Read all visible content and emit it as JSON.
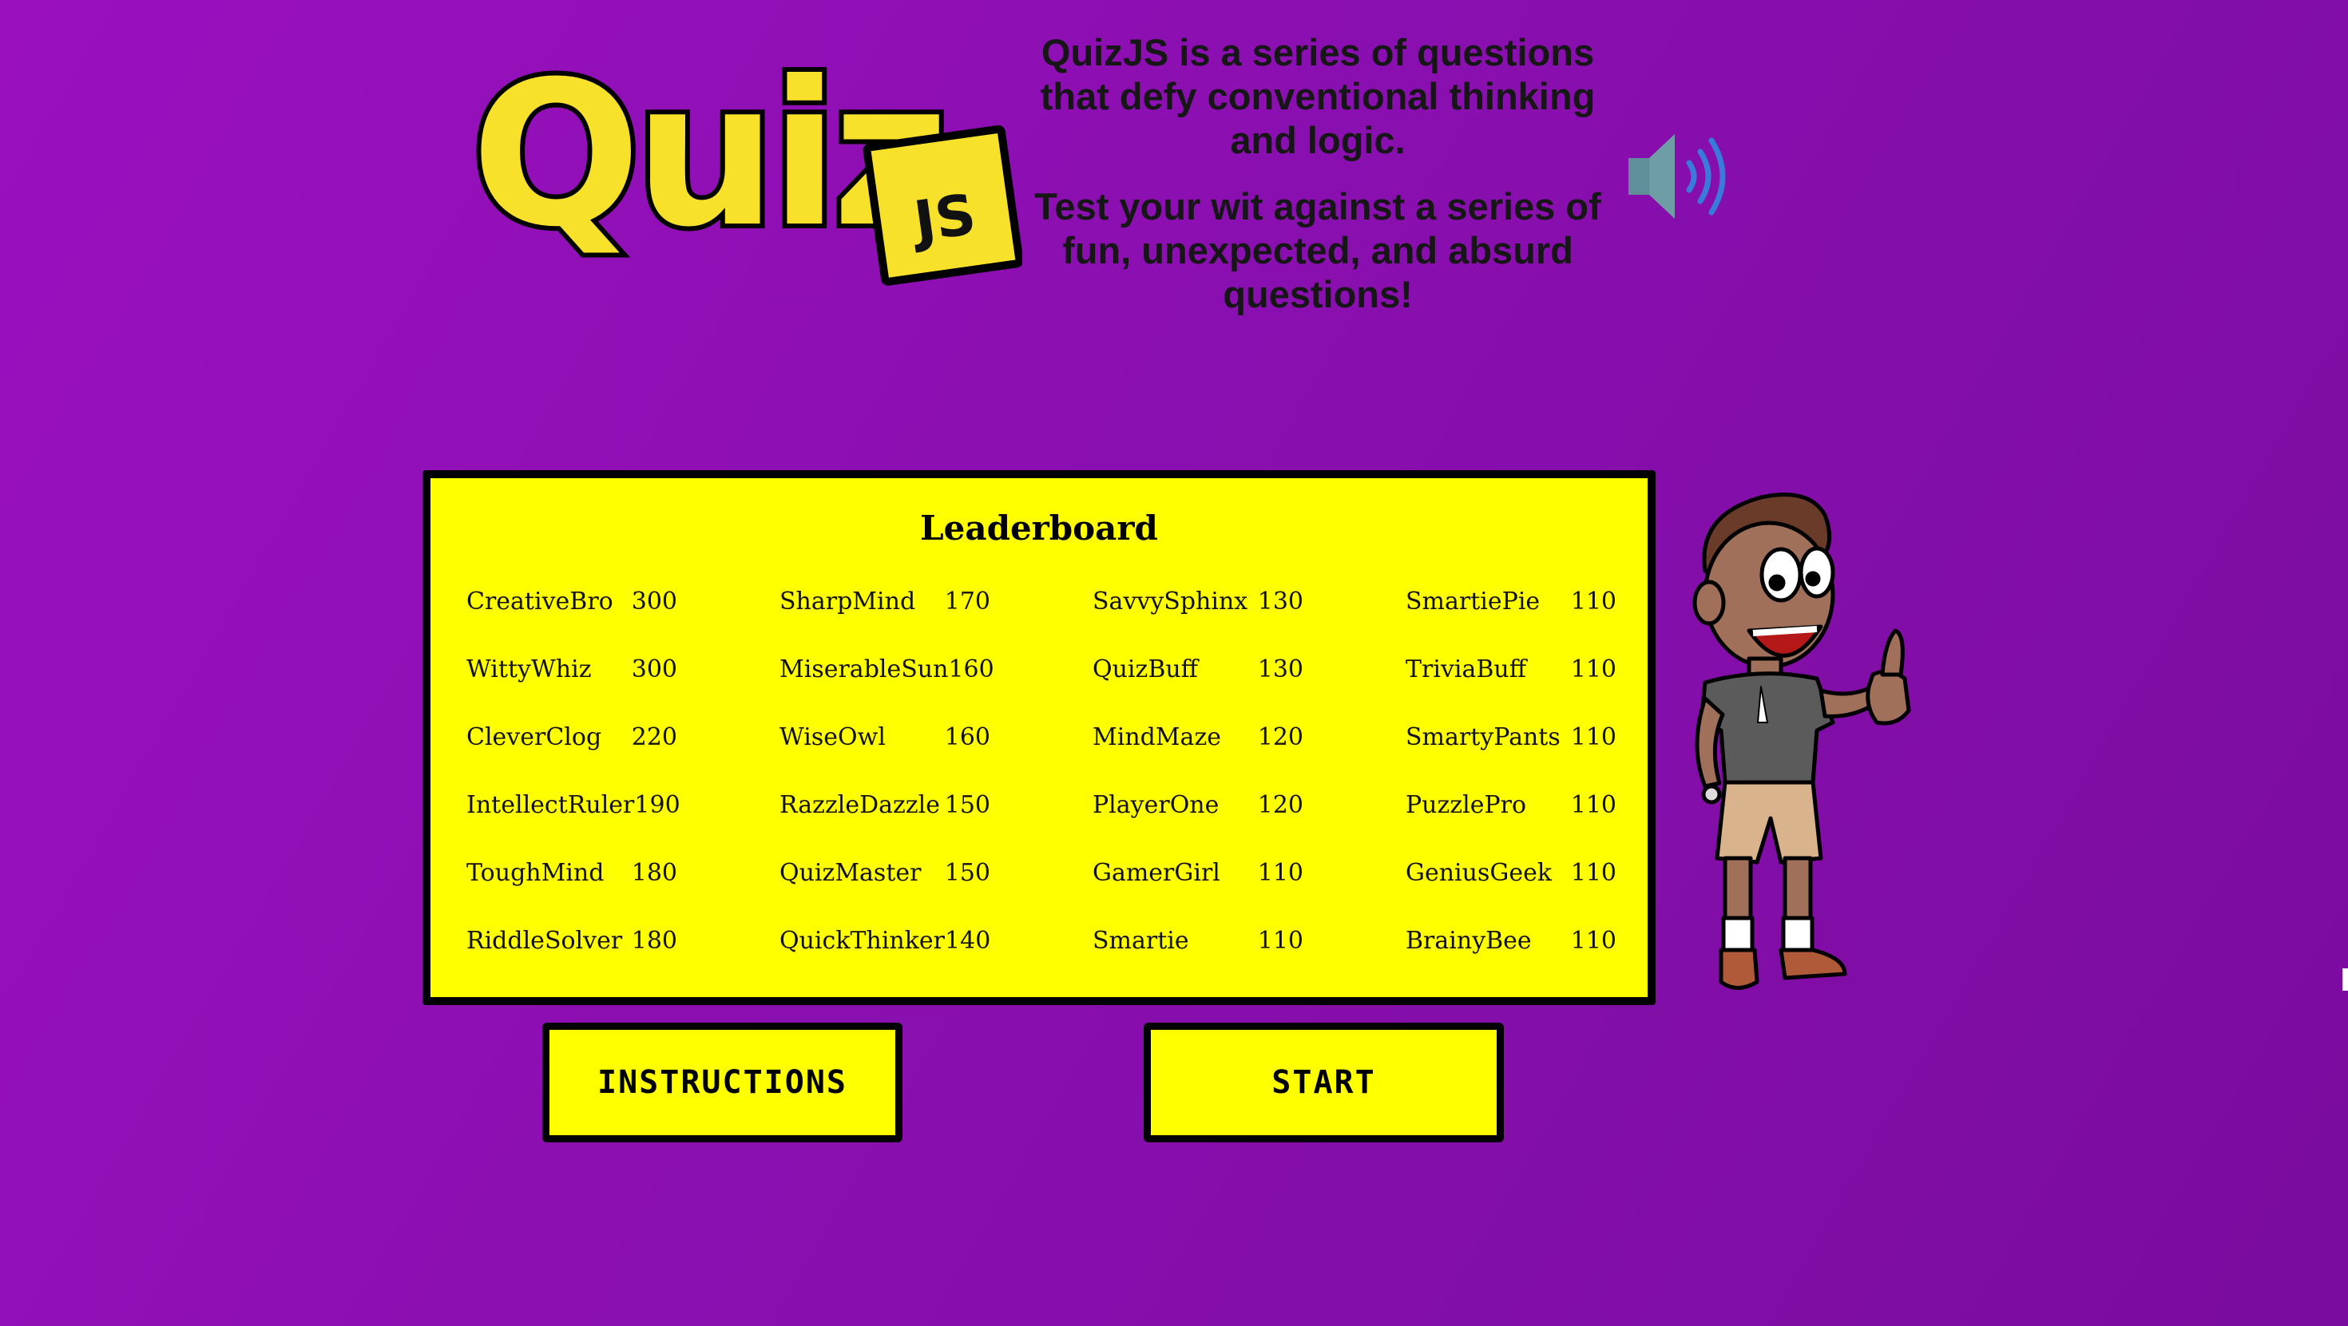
{
  "logo": {
    "word": "Quiz",
    "badge": "JS",
    "colors": {
      "fill": "#f7e12a",
      "outline": "#000000"
    }
  },
  "intro": {
    "paragraph1": "QuizJS is a series of questions that defy conventional thinking and logic.",
    "paragraph2": "Test your wit against a series of fun, unexpected, and absurd questions!"
  },
  "sound_icon": "speaker-on-icon",
  "leaderboard": {
    "title": "Leaderboard",
    "entries": [
      {
        "name": "CreativeBro",
        "score": "300"
      },
      {
        "name": "WittyWhiz",
        "score": "300"
      },
      {
        "name": "CleverClog",
        "score": "220"
      },
      {
        "name": "IntellectRuler",
        "score": "190"
      },
      {
        "name": "ToughMind",
        "score": "180"
      },
      {
        "name": "RiddleSolver",
        "score": "180"
      },
      {
        "name": "SharpMind",
        "score": "170"
      },
      {
        "name": "MiserableSun",
        "score": "160"
      },
      {
        "name": "WiseOwl",
        "score": "160"
      },
      {
        "name": "RazzleDazzle",
        "score": "150"
      },
      {
        "name": "QuizMaster",
        "score": "150"
      },
      {
        "name": "QuickThinker",
        "score": "140"
      },
      {
        "name": "SavvySphinx",
        "score": "130"
      },
      {
        "name": "QuizBuff",
        "score": "130"
      },
      {
        "name": "MindMaze",
        "score": "120"
      },
      {
        "name": "PlayerOne",
        "score": "120"
      },
      {
        "name": "GamerGirl",
        "score": "110"
      },
      {
        "name": "Smartie",
        "score": "110"
      },
      {
        "name": "SmartiePie",
        "score": "110"
      },
      {
        "name": "TriviaBuff",
        "score": "110"
      },
      {
        "name": "SmartyPants",
        "score": "110"
      },
      {
        "name": "PuzzlePro",
        "score": "110"
      },
      {
        "name": "GeniusGeek",
        "score": "110"
      },
      {
        "name": "BrainyBee",
        "score": "110"
      }
    ]
  },
  "buttons": {
    "instructions": "INSTRUCTIONS",
    "start": "START"
  },
  "colors": {
    "background_start": "#9a10bf",
    "background_end": "#7a0c9f",
    "panel": "#ffff00",
    "border": "#000000"
  }
}
